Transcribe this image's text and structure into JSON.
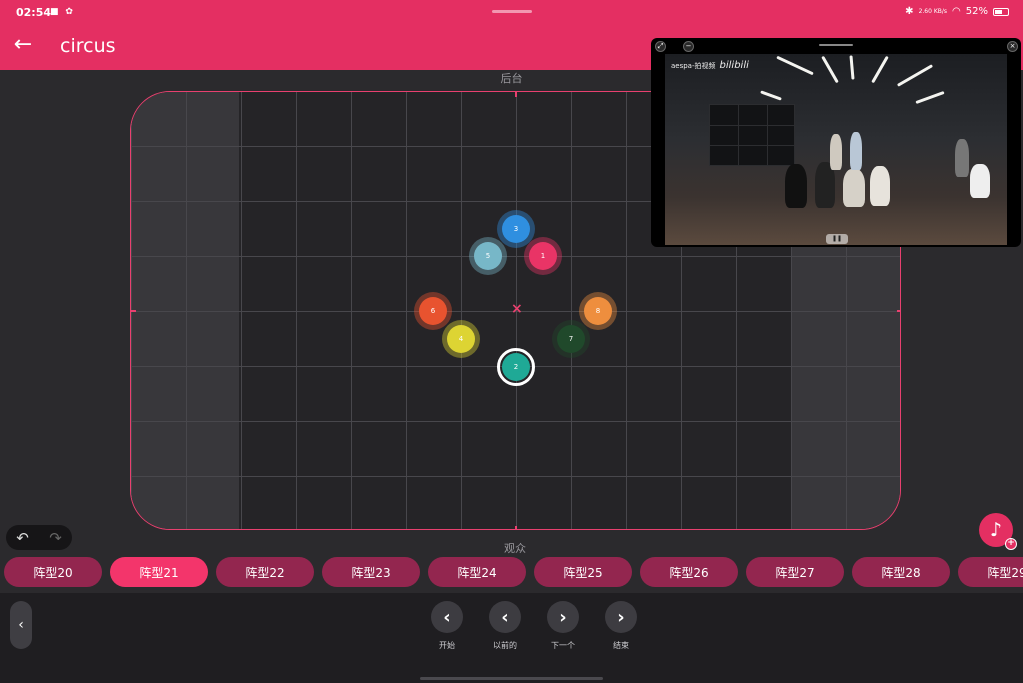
{
  "status": {
    "time": "02:54",
    "network": "2.60 KB/s",
    "battery": "52%",
    "battery_level": 0.52
  },
  "header": {
    "title": "circus",
    "back_icon": "arrow-left-icon"
  },
  "stage": {
    "back_label": "后台",
    "front_label": "观众",
    "dancers": [
      {
        "label": "3",
        "color": "#2f8fe0"
      },
      {
        "label": "5",
        "color": "#77b7c8"
      },
      {
        "label": "1",
        "color": "#e93466"
      },
      {
        "label": "6",
        "color": "#e8532f"
      },
      {
        "label": "8",
        "color": "#ee8e3e"
      },
      {
        "label": "4",
        "color": "#ddd433"
      },
      {
        "label": "7",
        "color": "#20492b"
      },
      {
        "label": "2",
        "color": "#1fa996"
      }
    ]
  },
  "video": {
    "caption": "aespa-拍视频",
    "brand": "bilibili",
    "icons": [
      "expand-icon",
      "minimize-icon",
      "close-icon"
    ]
  },
  "formations": [
    "阵型20",
    "阵型21",
    "阵型22",
    "阵型23",
    "阵型24",
    "阵型25",
    "阵型26",
    "阵型27",
    "阵型28",
    "阵型29"
  ],
  "active_formation": "阵型21",
  "nav": {
    "start_label": "开始",
    "prev_label": "以前的",
    "next_label": "下一个",
    "end_label": "结束"
  }
}
